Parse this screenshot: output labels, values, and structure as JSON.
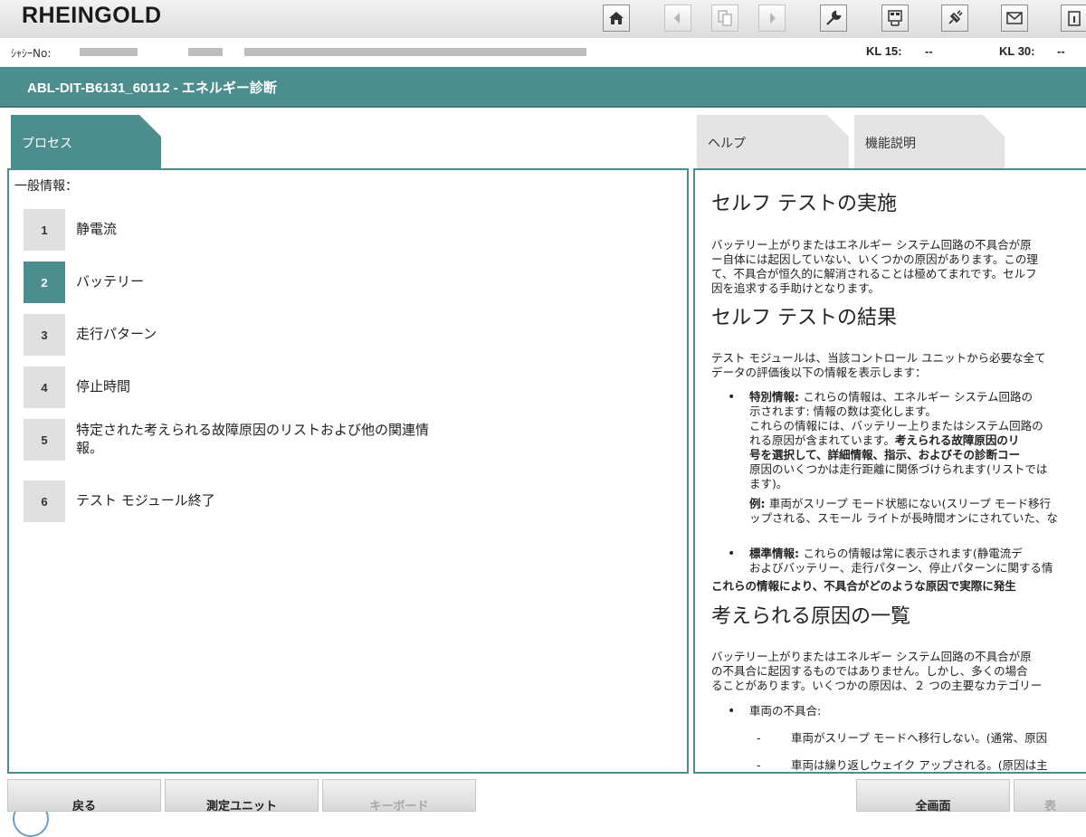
{
  "app": {
    "title": "RHEINGOLD"
  },
  "info": {
    "chassis_label": "ｼｬｼｰNo:",
    "kl15_label": "KL 15:",
    "kl15_value": "--",
    "kl30_label": "KL 30:",
    "kl30_value": "--"
  },
  "header": {
    "title": "ABL-DIT-B6131_60112 - エネルギー診断"
  },
  "tabs": {
    "process": "プロセス",
    "help": "ヘルプ",
    "function": "機能説明"
  },
  "process": {
    "title": "一般情報：",
    "steps": [
      {
        "num": "1",
        "label": "静電流"
      },
      {
        "num": "2",
        "label": "バッテリー"
      },
      {
        "num": "3",
        "label": "走行パターン"
      },
      {
        "num": "4",
        "label": "停止時間"
      },
      {
        "num": "5",
        "label_line1": "特定された考えられる故障原因のリストおよび他の関連情",
        "label_line2": "報。"
      },
      {
        "num": "6",
        "label": "テスト モジュール終了"
      }
    ],
    "active_step": "2"
  },
  "help": {
    "h1": "セルフ テストの実施",
    "p1": [
      "バッテリー上がりまたはエネルギー システム回路の不具合が原",
      "ー自体には起因していない、いくつかの原因があります。この理",
      "て、不具合が恒久的に解消されることは極めてまれです。セルフ",
      "因を追求する手助けとなります。"
    ],
    "h2": "セルフ テストの結果",
    "p2": [
      "テスト モジュールは、当該コントロール ユニットから必要な全て",
      "データの評価後以下の情報を表示します："
    ],
    "b1_lead": "特別情報: ",
    "b1_line1_rest": "これらの情報は、エネルギー システム回路の",
    "b1_line2": "示されます: 情報の数は変化します。",
    "b1_line3": "これらの情報には、バッテリー上りまたはシステム回路の",
    "b1_line4_a": "れる原因が含まれています。",
    "b1_line4_b": "考えられる故障原因のリ",
    "b1_line5": "号を選択して、詳細情報、指示、およびその診断コー",
    "b1_line6": "原因のいくつかは走行距離に関係づけられます(リストでは",
    "b1_line7": "ます)。",
    "b1_ex_lead": "例: ",
    "b1_ex_line1_rest": "車両がスリープ モード状態にない(スリープ モード移行",
    "b1_ex_line2": "ップされる、スモール ライトが長時間オンにされていた、な",
    "b2_lead": "標準情報: ",
    "b2_line1_rest": "これらの情報は常に表示されます(静電流デ",
    "b2_line2": "およびバッテリー、走行パターン、停止パターンに関する情",
    "bold_line": "これらの情報により、不具合がどのような原因で実際に発生",
    "h3": "考えられる原因の一覧",
    "p3": [
      "バッテリー上がりまたはエネルギー システム回路の不具合が原",
      "の不具合に起因するものではありません。しかし、多くの場合",
      "ることがあります。いくつかの原因は、２ つの主要なカテゴリー"
    ],
    "b3": "車両の不具合:",
    "sub1": "車両がスリープ モードへ移行しない。(通常、原因",
    "sub2": "車両は繰り返しウェイク アップされる。(原因は主"
  },
  "bottom": {
    "back": "戻る",
    "measure": "測定ユニット",
    "keyboard": "キーボード",
    "fullscreen": "全画面",
    "cut_label": "表"
  }
}
